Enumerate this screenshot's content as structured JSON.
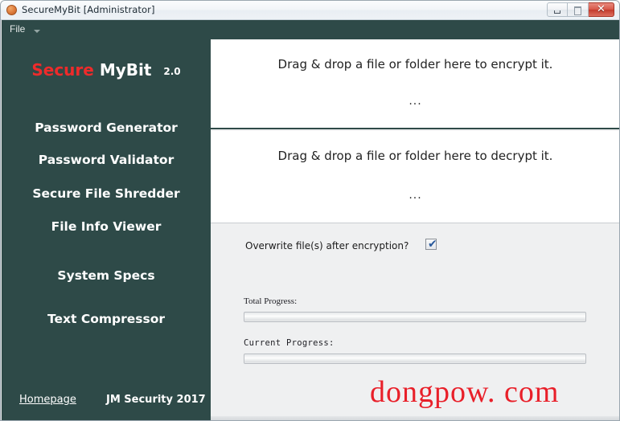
{
  "window": {
    "title": "SecureMyBit [Administrator]",
    "app_icon": "app-circle-icon",
    "controls": {
      "minimize": "minimize-icon",
      "maximize": "maximize-icon",
      "close_label": "✕"
    }
  },
  "menubar": {
    "items": [
      {
        "label": "File",
        "caret": "chevron-down-icon"
      }
    ]
  },
  "sidebar": {
    "logo": {
      "part1": "Secure",
      "part2": "MyBit",
      "version": "2.0",
      "part1_color": "#ee2b2b",
      "part2_color": "#ffffff"
    },
    "items": [
      {
        "label": "Password Generator"
      },
      {
        "label": "Password Validator"
      },
      {
        "label": "Secure File Shredder"
      },
      {
        "label": "File Info Viewer"
      },
      {
        "label": "System Specs"
      },
      {
        "label": "Text Compressor"
      }
    ],
    "footer": {
      "homepage_label": "Homepage",
      "copyright": "JM Security 2017 ©"
    },
    "background_color": "#2e4a48"
  },
  "main": {
    "encrypt_zone": {
      "title": "Drag & drop a file or folder here to encrypt it.",
      "status": "..."
    },
    "decrypt_zone": {
      "title": "Drag & drop a file or folder here to decrypt it.",
      "status": "..."
    },
    "overwrite": {
      "label": "Overwrite file(s) after encryption?",
      "checked": true,
      "check_glyph": "✔"
    },
    "progress": {
      "total": {
        "label": "Total Progress:",
        "percent": 0
      },
      "current": {
        "label": "Current Progress:",
        "percent": 0
      }
    }
  },
  "watermark": {
    "text": "dongpow. com",
    "color": "#e8202a"
  }
}
